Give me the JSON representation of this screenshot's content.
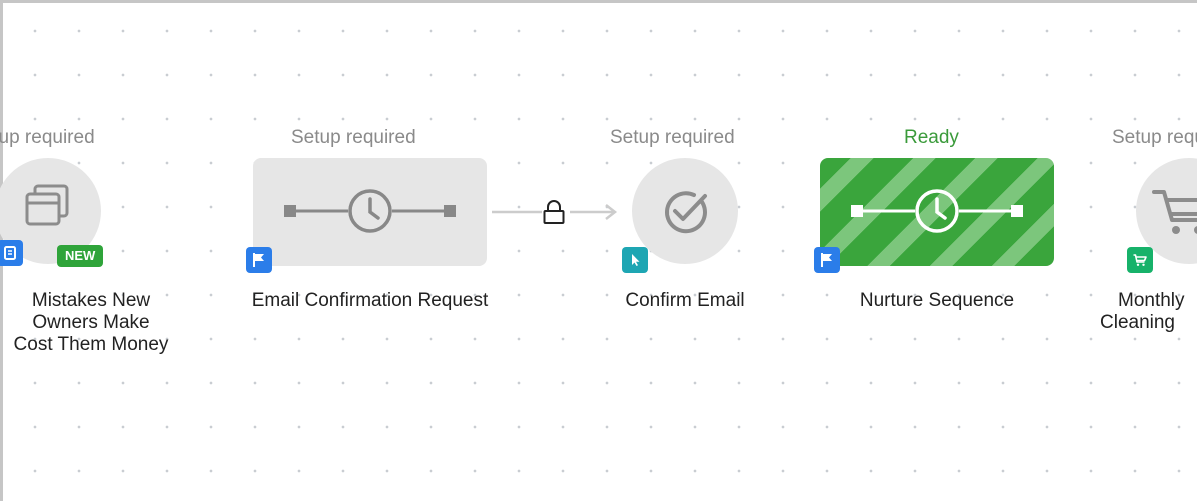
{
  "colors": {
    "node_gray": "#e6e6e6",
    "ready_green": "#3aa53c",
    "flag_blue": "#2b7de9",
    "pointer_teal": "#1ea6b3",
    "cart_green": "#17b26a"
  },
  "nodes": [
    {
      "status": "Setup required",
      "title_lines": [
        "Mistakes New",
        "Owners Make",
        "Cost Them Money"
      ],
      "tag": "NEW",
      "icon": "windows-icon",
      "badge_icon": "page-icon"
    },
    {
      "status": "Setup required",
      "title": "Email Confirmation Request",
      "icon": "delay-timer-icon",
      "badge_icon": "flag-icon"
    },
    {
      "status": "Setup required",
      "title": "Confirm Email",
      "icon": "check-circle-icon",
      "badge_icon": "pointer-icon"
    },
    {
      "status": "Ready",
      "title": "Nurture Sequence",
      "icon": "delay-timer-icon",
      "badge_icon": "flag-icon"
    },
    {
      "status": "Setup required",
      "title_lines": [
        "Monthly",
        "Cleaning"
      ],
      "icon": "cart-icon",
      "badge_icon": "cart-icon"
    }
  ],
  "connectors": [
    {
      "from": "Email Confirmation Request",
      "to": "Confirm Email",
      "icon": "lock-icon"
    }
  ]
}
